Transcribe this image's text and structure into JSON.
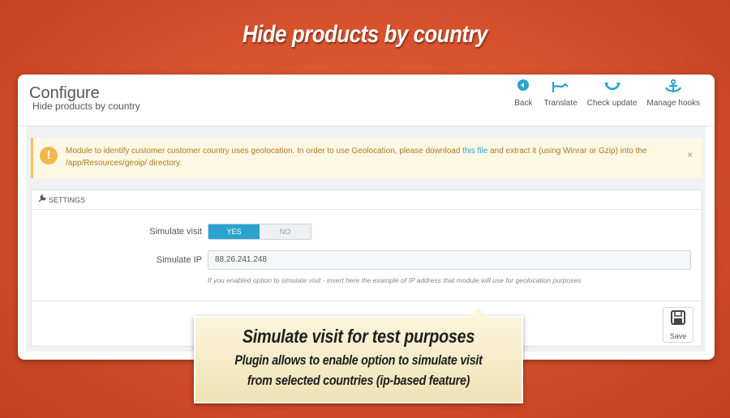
{
  "banner": {
    "title": "Hide products by country"
  },
  "header": {
    "title": "Configure",
    "subtitle": "Hide products by country",
    "toolbar": [
      {
        "label": "Back",
        "icon": "back-icon"
      },
      {
        "label": "Translate",
        "icon": "translate-icon"
      },
      {
        "label": "Check update",
        "icon": "refresh-icon"
      },
      {
        "label": "Manage hooks",
        "icon": "anchor-icon"
      }
    ]
  },
  "alert": {
    "text_before": "Module to identify customer customer country uses geolocation. In order to use Geolocation, please download",
    "link": "this file",
    "text_after": "and extract it (using Winrar or Gzip) into the /app/Resources/geoip/ directory.",
    "close": "×",
    "icon": "!"
  },
  "settings": {
    "title": "SETTINGS",
    "simulate_label": "Simulate visit",
    "yes_label": "YES",
    "no_label": "NO",
    "simulate_value": "YES",
    "ip_label": "Simulate IP",
    "ip_value": "88.26.241.248",
    "help": "If you enabled option to simulate visit - insert here the example of IP address that module will use for geolocation purposes",
    "save_label": "Save"
  },
  "callout": {
    "title": "Simulate visit for test purposes",
    "line1": "Plugin allows to enable option to simulate visit",
    "line2": "from selected countries (ip-based feature)"
  },
  "colors": {
    "accent": "#2aa4cf",
    "background": "#d9532e",
    "alert_bg": "#fcf8e3"
  }
}
